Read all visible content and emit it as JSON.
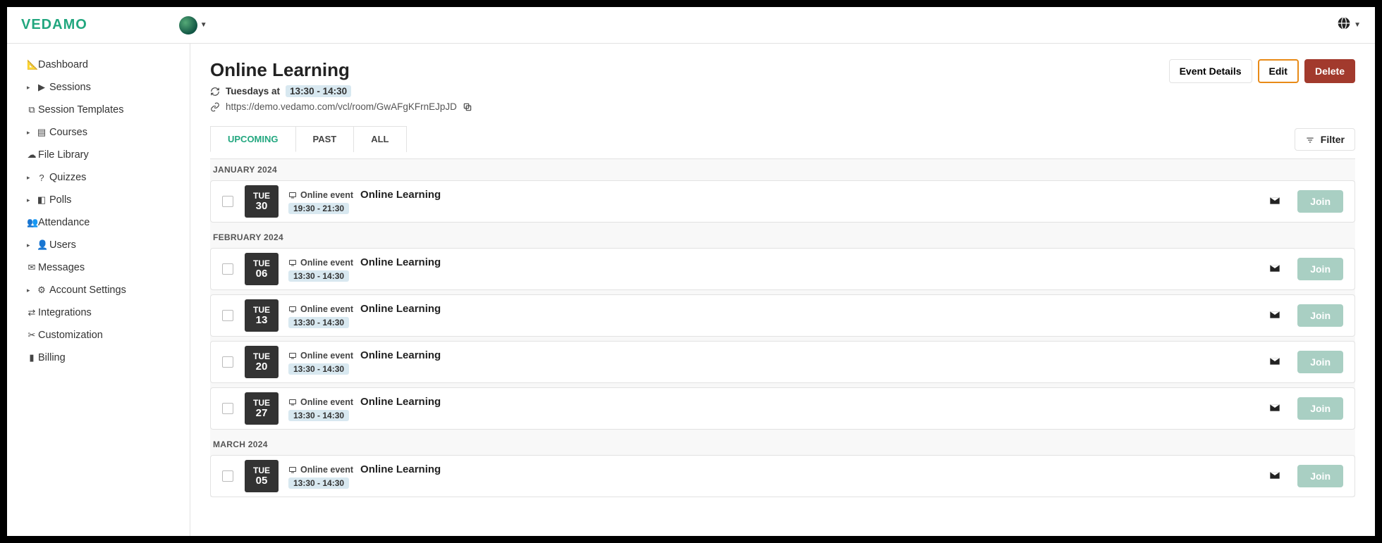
{
  "brand": "VEDAMO",
  "sidebar": [
    {
      "icon": "📐",
      "label": "Dashboard",
      "expandable": false
    },
    {
      "icon": "▶",
      "label": "Sessions",
      "expandable": true
    },
    {
      "icon": "⧉",
      "label": "Session Templates",
      "expandable": false
    },
    {
      "icon": "▤",
      "label": "Courses",
      "expandable": true
    },
    {
      "icon": "☁",
      "label": "File Library",
      "expandable": false
    },
    {
      "icon": "?",
      "label": "Quizzes",
      "expandable": true
    },
    {
      "icon": "◧",
      "label": "Polls",
      "expandable": true
    },
    {
      "icon": "👥",
      "label": "Attendance",
      "expandable": false
    },
    {
      "icon": "👤",
      "label": "Users",
      "expandable": true
    },
    {
      "icon": "✉",
      "label": "Messages",
      "expandable": false
    },
    {
      "icon": "⚙",
      "label": "Account Settings",
      "expandable": true
    },
    {
      "icon": "⇄",
      "label": "Integrations",
      "expandable": false
    },
    {
      "icon": "✂",
      "label": "Customization",
      "expandable": false
    },
    {
      "icon": "▮",
      "label": "Billing",
      "expandable": false
    }
  ],
  "page": {
    "title": "Online Learning",
    "recurrence_prefix": "Tuesdays at",
    "recurrence_time": "13:30 - 14:30",
    "url": "https://demo.vedamo.com/vcl/room/GwAFgKFrnEJpJD"
  },
  "actions": {
    "details": "Event Details",
    "edit": "Edit",
    "delete": "Delete",
    "filter": "Filter",
    "join": "Join"
  },
  "tabs": {
    "upcoming": "UPCOMING",
    "past": "PAST",
    "all": "ALL"
  },
  "labels": {
    "online_event": "Online event"
  },
  "groups": [
    {
      "month": "JANUARY 2024",
      "events": [
        {
          "dow": "TUE",
          "day": "30",
          "title": "Online Learning",
          "time": "19:30 - 21:30"
        }
      ]
    },
    {
      "month": "FEBRUARY 2024",
      "events": [
        {
          "dow": "TUE",
          "day": "06",
          "title": "Online Learning",
          "time": "13:30 - 14:30"
        },
        {
          "dow": "TUE",
          "day": "13",
          "title": "Online Learning",
          "time": "13:30 - 14:30"
        },
        {
          "dow": "TUE",
          "day": "20",
          "title": "Online Learning",
          "time": "13:30 - 14:30"
        },
        {
          "dow": "TUE",
          "day": "27",
          "title": "Online Learning",
          "time": "13:30 - 14:30"
        }
      ]
    },
    {
      "month": "MARCH 2024",
      "events": [
        {
          "dow": "TUE",
          "day": "05",
          "title": "Online Learning",
          "time": "13:30 - 14:30"
        }
      ]
    }
  ]
}
